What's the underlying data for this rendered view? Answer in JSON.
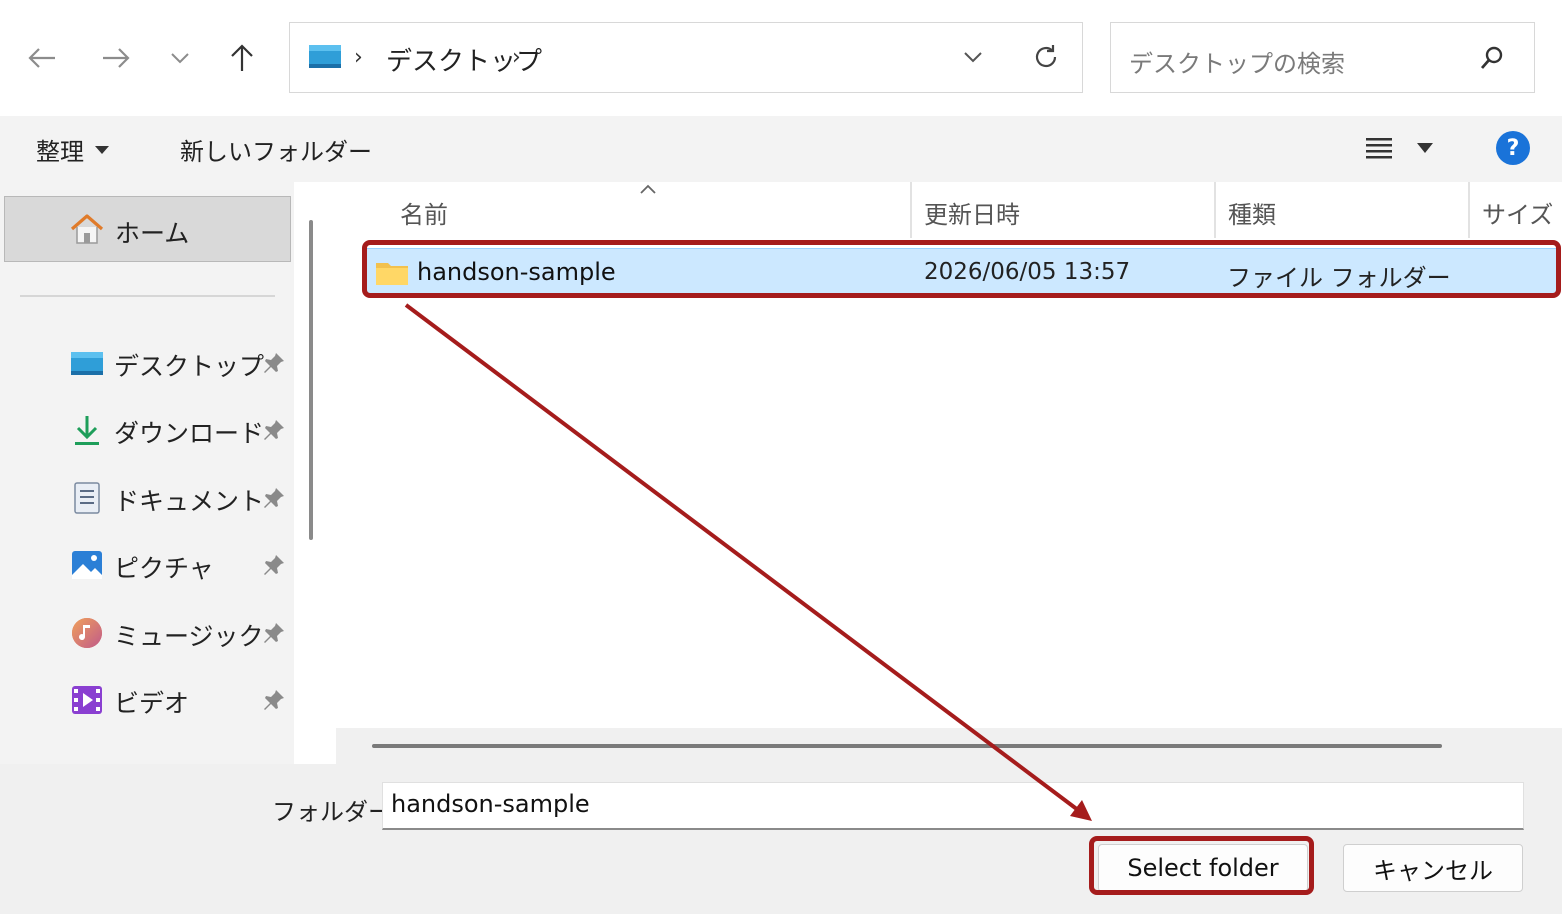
{
  "address_bar": {
    "breadcrumb": "デスクトップ",
    "separator": "›",
    "search_placeholder": "デスクトップの検索"
  },
  "toolbar": {
    "organize_label": "整理",
    "new_folder_label": "新しいフォルダー",
    "help_label": "?"
  },
  "nav": {
    "home_label": "ホーム",
    "items": [
      {
        "label": "デスクトップ",
        "icon": "desktop-icon"
      },
      {
        "label": "ダウンロード",
        "icon": "download-icon"
      },
      {
        "label": "ドキュメント",
        "icon": "document-icon"
      },
      {
        "label": "ピクチャ",
        "icon": "picture-icon"
      },
      {
        "label": "ミュージック",
        "icon": "music-icon"
      },
      {
        "label": "ビデオ",
        "icon": "video-icon"
      }
    ]
  },
  "columns": [
    "名前",
    "更新日時",
    "種類",
    "サイズ"
  ],
  "rows": [
    {
      "name": "handson-sample",
      "modified": "2026/06/05 13:57",
      "type": "ファイル フォルダー",
      "selected": true
    }
  ],
  "bottom": {
    "folder_label": "フォルダー:",
    "folder_value": "handson-sample",
    "select_button": "Select folder",
    "cancel_button": "キャンセル"
  },
  "colors": {
    "annotation": "#a51c1c",
    "selection_bg": "#cce8ff",
    "help_blue": "#1a73d9"
  }
}
